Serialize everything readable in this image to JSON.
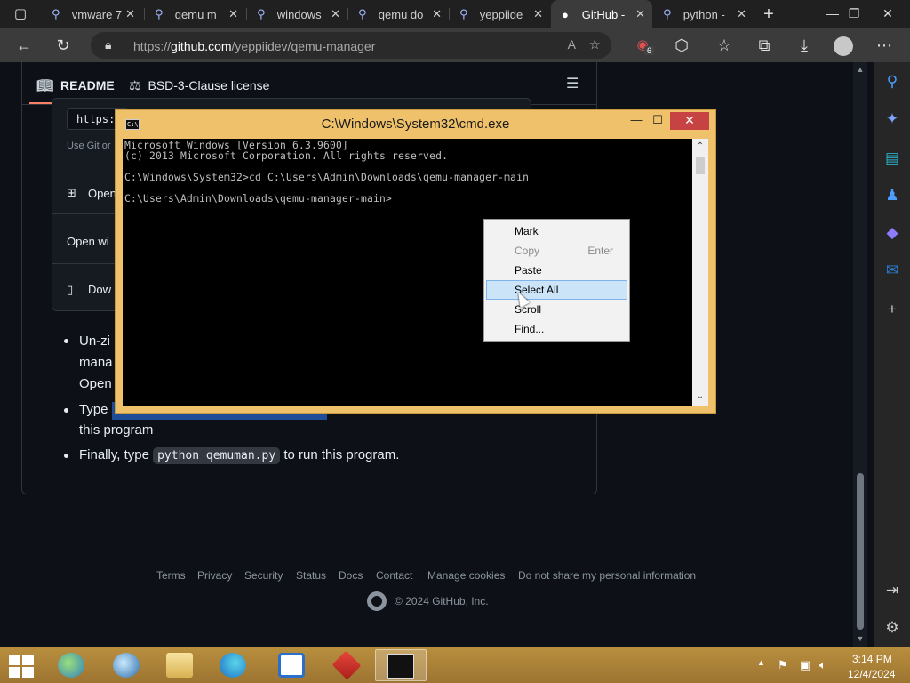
{
  "browser": {
    "tabs": [
      {
        "icon": "search-icon",
        "label": "vmware 7"
      },
      {
        "icon": "search-icon",
        "label": "qemu m"
      },
      {
        "icon": "search-icon",
        "label": "windows"
      },
      {
        "icon": "search-icon",
        "label": "qemu do"
      },
      {
        "icon": "search-icon",
        "label": "yeppiide"
      },
      {
        "icon": "github-icon",
        "label": "GitHub -"
      },
      {
        "icon": "search-icon",
        "label": "python -"
      }
    ],
    "active_tab_index": 5,
    "url_prefix": "https://",
    "url_host": "github.com",
    "url_path": "/yeppiidev/qemu-manager",
    "extension_badge": "6"
  },
  "readme": {
    "tab_readme": "README",
    "tab_license": "BSD-3-Clause license",
    "clone_url": "https:",
    "use_git_text": "Use Git or",
    "open_with_desktop": "Open",
    "open_with": "Open wi",
    "download_zip": "Dow",
    "list": [
      {
        "line1": "Un-zi",
        "line2": "mana",
        "line3": "Open"
      },
      {
        "line1_pre": "Type",
        "line2": "this program"
      },
      {
        "pre": "Finally, type",
        "code": "python qemuman.py",
        "post": "to run this program."
      }
    ]
  },
  "footer": {
    "links": [
      "Terms",
      "Privacy",
      "Security",
      "Status",
      "Docs",
      "Contact",
      "Manage cookies",
      "Do not share my personal information"
    ],
    "copyright": "© 2024 GitHub, Inc."
  },
  "cmd": {
    "title": "C:\\Windows\\System32\\cmd.exe",
    "lines": [
      "Microsoft Windows [Version 6.3.9600]",
      "(c) 2013 Microsoft Corporation. All rights reserved.",
      "",
      "C:\\Windows\\System32>cd C:\\Users\\Admin\\Downloads\\qemu-manager-main",
      "",
      "C:\\Users\\Admin\\Downloads\\qemu-manager-main>"
    ]
  },
  "context_menu": {
    "items": [
      {
        "label": "Mark",
        "accel": "",
        "disabled": false
      },
      {
        "label": "Copy",
        "accel": "Enter",
        "disabled": true
      },
      {
        "label": "Paste",
        "accel": "",
        "disabled": false
      },
      {
        "label": "Select All",
        "accel": "",
        "disabled": false
      },
      {
        "label": "Scroll",
        "accel": "",
        "disabled": false
      },
      {
        "label": "Find...",
        "accel": "",
        "disabled": false
      }
    ],
    "highlighted_index": 3
  },
  "taskbar": {
    "time": "3:14 PM",
    "date": "12/4/2024"
  },
  "colors": {
    "cmd_frame": "#efc16a",
    "taskbar": "#b08538",
    "github_bg": "#0d1117",
    "menu_highlight": "#cce4f7"
  }
}
